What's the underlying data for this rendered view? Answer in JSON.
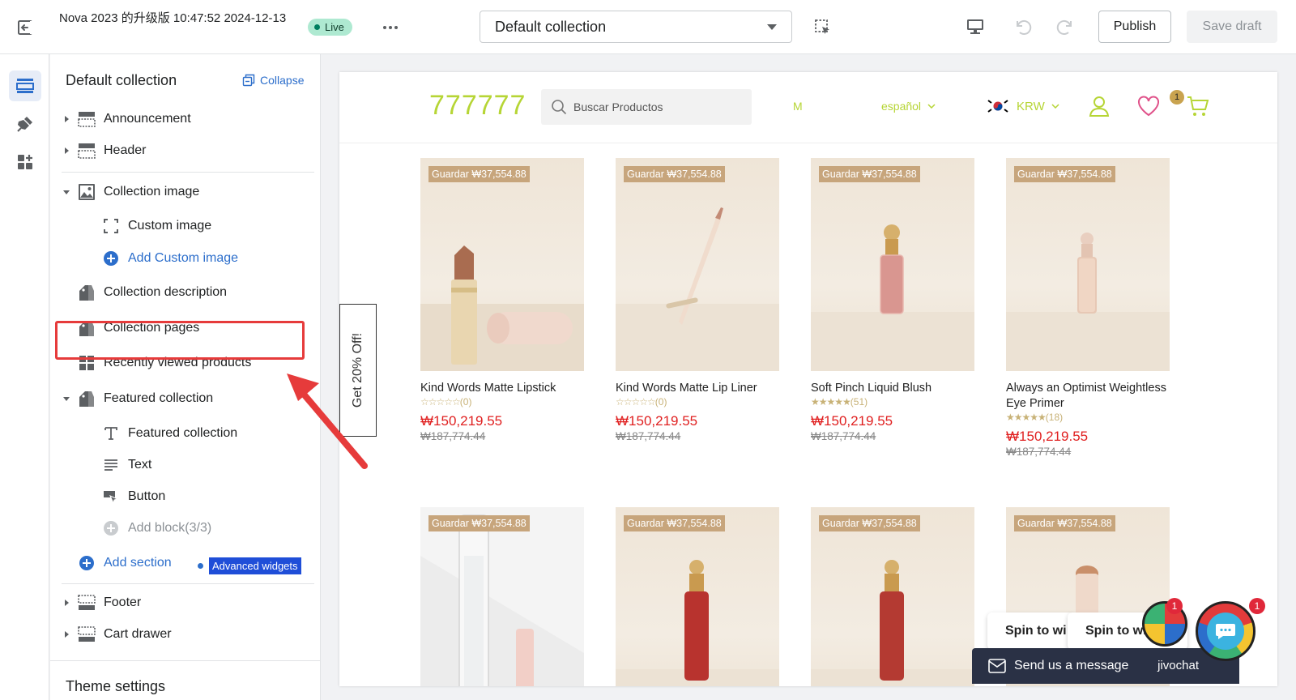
{
  "topbar": {
    "store_title": "Nova 2023 的升级版 10:47:52 2024-12-13",
    "live_label": "Live",
    "template_select": "Default collection",
    "publish_label": "Publish",
    "save_draft_label": "Save draft"
  },
  "sidebar": {
    "heading": "Default collection",
    "collapse_label": "Collapse",
    "items": {
      "announcement": "Announcement",
      "header": "Header",
      "collection_image": "Collection image",
      "custom_image": "Custom image",
      "add_custom_image": "Add Custom image",
      "collection_description": "Collection description",
      "collection_pages": "Collection pages",
      "recently_viewed": "Recently viewed products",
      "featured_collection": "Featured collection",
      "featured_collection_title": "Featured collection",
      "text": "Text",
      "button": "Button",
      "add_block": "Add block(3/3)",
      "add_section": "Add section",
      "advanced_widgets": "Advanced widgets",
      "footer": "Footer",
      "cart_drawer": "Cart drawer"
    },
    "theme_settings": "Theme settings"
  },
  "store": {
    "logo": "777777",
    "search_placeholder": "Buscar Productos",
    "nav_item": "M",
    "language": "español",
    "currency": "KRW",
    "wishlist_count": "1",
    "side_tab": "Get 20% Off!",
    "colors": {
      "accent": "#b6d535",
      "price": "#e02020",
      "tag": "#c7a57c"
    }
  },
  "products": [
    {
      "tag": "Guardar ₩37,554.88",
      "name": "Kind Words Matte Lipstick",
      "stars": "☆☆☆☆☆",
      "reviews": "(0)",
      "price": "₩150,219.55",
      "old": "₩187,774.44"
    },
    {
      "tag": "Guardar ₩37,554.88",
      "name": "Kind Words Matte Lip Liner",
      "stars": "☆☆☆☆☆",
      "reviews": "(0)",
      "price": "₩150,219.55",
      "old": "₩187,774.44"
    },
    {
      "tag": "Guardar ₩37,554.88",
      "name": "Soft Pinch Liquid Blush",
      "stars": "★★★★★",
      "reviews": "(51)",
      "price": "₩150,219.55",
      "old": "₩187,774.44"
    },
    {
      "tag": "Guardar ₩37,554.88",
      "name": "Always an Optimist Weightless Eye Primer",
      "stars": "★★★★★",
      "reviews": "(18)",
      "price": "₩150,219.55",
      "old": "₩187,774.44"
    },
    {
      "tag": "Guardar ₩37,554.88"
    },
    {
      "tag": "Guardar ₩37,554.88"
    },
    {
      "tag": "Guardar ₩37,554.88"
    },
    {
      "tag": "Guardar ₩37,554.88"
    }
  ],
  "widgets": {
    "spin_short": "Spin to wi",
    "spin_full": "Spin to win!",
    "send_message": "Send us a message",
    "chat_brand": "jivochat",
    "spin_badge": "1",
    "chat_badge": "1"
  }
}
